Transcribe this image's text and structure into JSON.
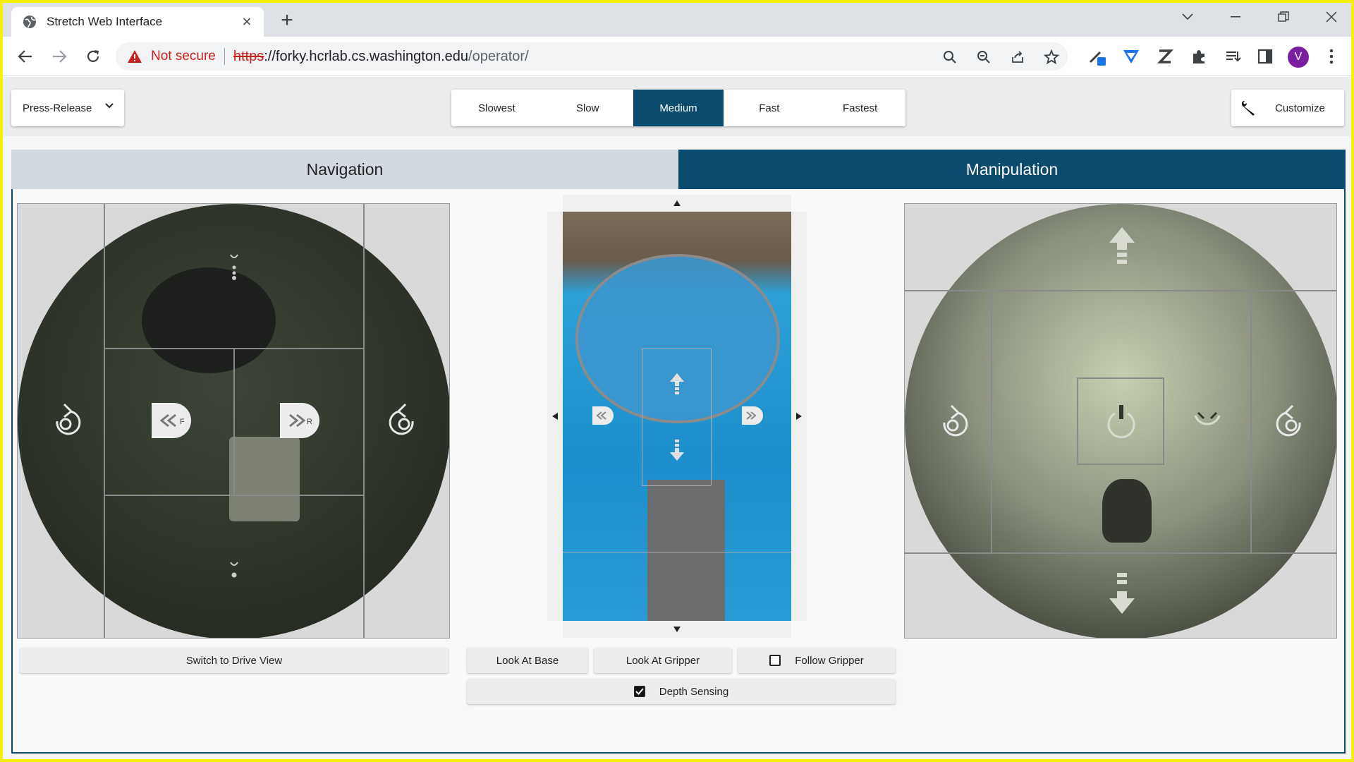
{
  "browser": {
    "tab_title": "Stretch Web Interface",
    "not_secure": "Not secure",
    "url_scheme": "https",
    "url_host": "://forky.hcrlab.cs.washington.edu",
    "url_path": "/operator/",
    "profile_initial": "V"
  },
  "header": {
    "mode_select": "Press-Release",
    "speeds": [
      "Slowest",
      "Slow",
      "Medium",
      "Fast",
      "Fastest"
    ],
    "active_speed": "Medium",
    "customize_label": "Customize"
  },
  "tabs": {
    "navigation": "Navigation",
    "manipulation": "Manipulation",
    "active": "Manipulation"
  },
  "controls": {
    "switch_view": "Switch to Drive View",
    "look_at_base": "Look At Base",
    "look_at_gripper": "Look At Gripper",
    "follow_gripper": "Follow Gripper",
    "follow_gripper_checked": false,
    "depth_sensing": "Depth Sensing",
    "depth_sensing_checked": true
  },
  "colors": {
    "accent": "#0b4b6e",
    "yellow_border": "#f4f00a",
    "not_secure_red": "#c5221f"
  },
  "icons": [
    "globe-icon",
    "close-icon",
    "plus-icon",
    "back-icon",
    "forward-icon",
    "reload-icon",
    "warning-icon",
    "zoom-icon",
    "zoom-out-icon",
    "share-icon",
    "star-icon",
    "puzzle-icon",
    "wrench-icon",
    "rotate-left-icon",
    "rotate-right-icon",
    "arrow-up-icon",
    "arrow-down-icon"
  ]
}
